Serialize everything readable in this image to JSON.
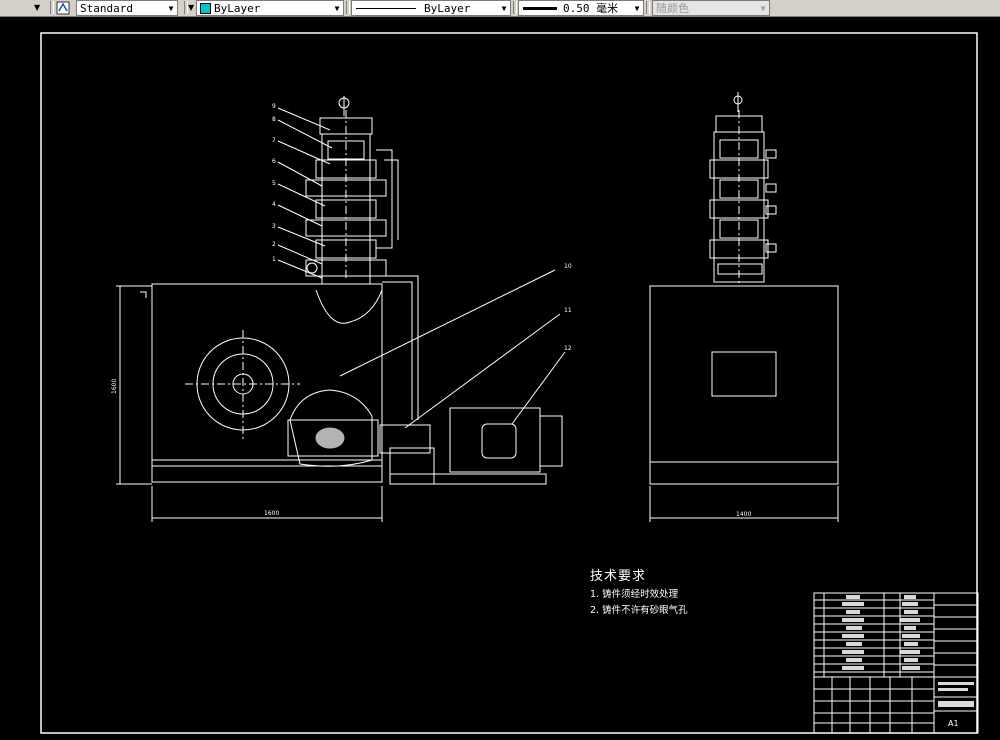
{
  "toolbar": {
    "text_style": "Standard",
    "layer_color": "ByLayer",
    "layer_color_swatch": "#00c8c8",
    "linetype": "ByLayer",
    "lineweight": "0.50 毫米",
    "plot_style": "随颜色"
  },
  "drawing": {
    "front_view": {
      "callouts": [
        "9",
        "8",
        "7",
        "6",
        "5",
        "4",
        "3",
        "2",
        "1",
        "10",
        "11",
        "12"
      ],
      "dim_width": "1600",
      "dim_height": "1600"
    },
    "side_view": {
      "dim_width": "1400"
    },
    "tech_requirements": {
      "title": "技术要求",
      "items": [
        "1. 铸件须经时效处理",
        "2. 铸件不许有砂眼气孔"
      ]
    },
    "title_block": {
      "scale": "A1"
    }
  }
}
